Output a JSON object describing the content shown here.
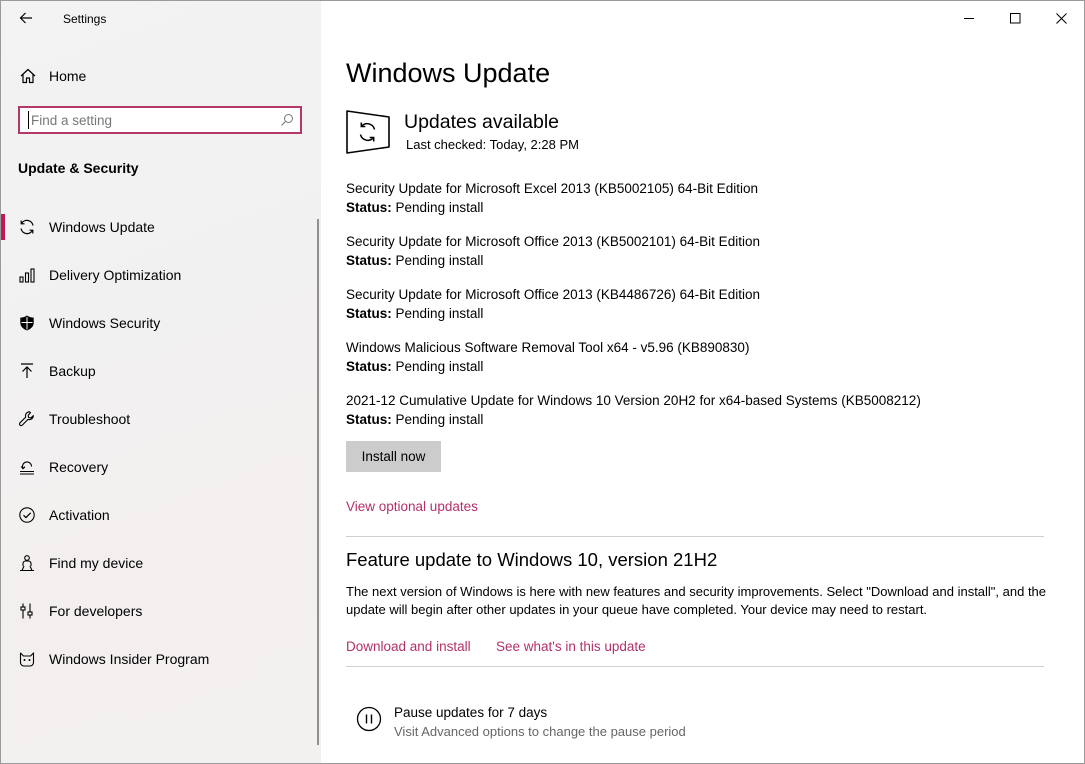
{
  "app": {
    "title": "Settings"
  },
  "sidebar": {
    "home_label": "Home",
    "search_placeholder": "Find a setting",
    "section_title": "Update & Security",
    "items": [
      {
        "label": "Windows Update",
        "icon": "sync-icon",
        "active": true
      },
      {
        "label": "Delivery Optimization",
        "icon": "delivery-optimization-icon",
        "active": false
      },
      {
        "label": "Windows Security",
        "icon": "shield-icon",
        "active": false
      },
      {
        "label": "Backup",
        "icon": "upload-arrow-icon",
        "active": false
      },
      {
        "label": "Troubleshoot",
        "icon": "wrench-icon",
        "active": false
      },
      {
        "label": "Recovery",
        "icon": "recovery-icon",
        "active": false
      },
      {
        "label": "Activation",
        "icon": "checkmark-circle-icon",
        "active": false
      },
      {
        "label": "Find my device",
        "icon": "person-pin-icon",
        "active": false
      },
      {
        "label": "For developers",
        "icon": "developer-sliders-icon",
        "active": false
      },
      {
        "label": "Windows Insider Program",
        "icon": "insider-cat-icon",
        "active": false
      }
    ]
  },
  "main": {
    "title": "Windows Update",
    "status_heading": "Updates available",
    "status_sub": "Last checked: Today, 2:28 PM",
    "status_label": "Status:",
    "updates": [
      {
        "name": "Security Update for Microsoft Excel 2013 (KB5002105) 64-Bit Edition",
        "status": "Pending install"
      },
      {
        "name": "Security Update for Microsoft Office 2013 (KB5002101) 64-Bit Edition",
        "status": "Pending install"
      },
      {
        "name": "Security Update for Microsoft Office 2013 (KB4486726) 64-Bit Edition",
        "status": "Pending install"
      },
      {
        "name": "Windows Malicious Software Removal Tool x64 - v5.96 (KB890830)",
        "status": "Pending install"
      },
      {
        "name": "2021-12 Cumulative Update for Windows 10 Version 20H2 for x64-based Systems (KB5008212)",
        "status": "Pending install"
      }
    ],
    "install_button": "Install now",
    "optional_link": "View optional updates",
    "feature": {
      "title": "Feature update to Windows 10, version 21H2",
      "description": "The next version of Windows is here with new features and security improvements. Select \"Download and install\", and the update will begin after other updates in your queue have completed. Your device may need to restart.",
      "download_link": "Download and install",
      "whats_new_link": "See what's in this update"
    },
    "pause": {
      "title": "Pause updates for 7 days",
      "subtitle": "Visit Advanced options to change the pause period"
    }
  },
  "colors": {
    "accent": "#c2185b",
    "link": "#b4306a",
    "button": "#cccccc"
  }
}
